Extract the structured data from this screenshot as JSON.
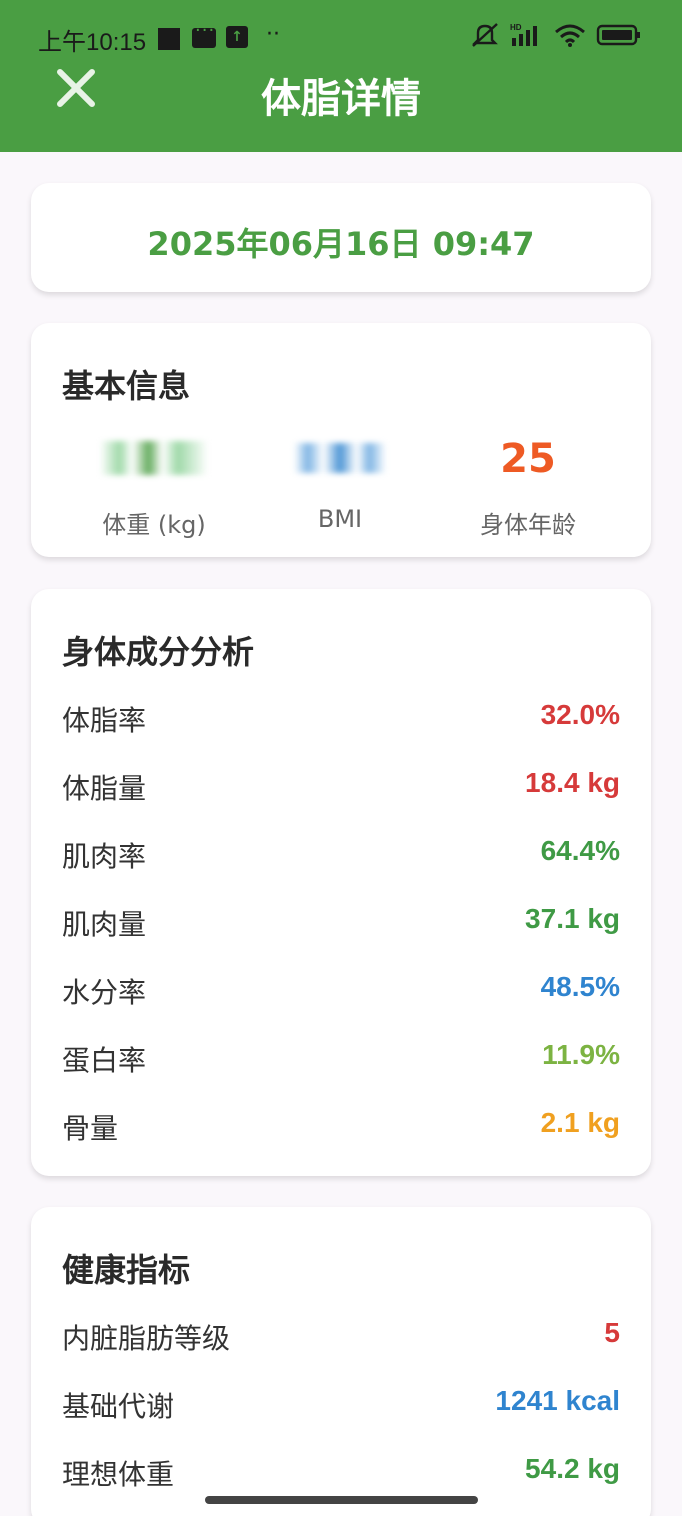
{
  "status_bar": {
    "time": "上午10:15",
    "dots": "··"
  },
  "header": {
    "title": "体脂详情",
    "close_icon": "close-icon"
  },
  "date": "2025年06月16日 09:47",
  "basic_info": {
    "title": "基本信息",
    "stats": [
      {
        "label": "体重 (kg)",
        "value": "",
        "note": "value obscured"
      },
      {
        "label": "BMI",
        "value": "",
        "note": "value obscured"
      },
      {
        "label": "身体年龄",
        "value": "25"
      }
    ]
  },
  "composition": {
    "title": "身体成分分析",
    "rows": [
      {
        "label": "体脂率",
        "value": "32.0%",
        "color": "#d63a3a"
      },
      {
        "label": "体脂量",
        "value": "18.4 kg",
        "color": "#d63a3a"
      },
      {
        "label": "肌肉率",
        "value": "64.4%",
        "color": "#3f9a45"
      },
      {
        "label": "肌肉量",
        "value": "37.1 kg",
        "color": "#3f9a45"
      },
      {
        "label": "水分率",
        "value": "48.5%",
        "color": "#2f84cf"
      },
      {
        "label": "蛋白率",
        "value": "11.9%",
        "color": "#7cb342"
      },
      {
        "label": "骨量",
        "value": "2.1 kg",
        "color": "#f0a020"
      }
    ]
  },
  "health": {
    "title": "健康指标",
    "rows": [
      {
        "label": "内脏脂肪等级",
        "value": "5",
        "color": "#d63a3a"
      },
      {
        "label": "基础代谢",
        "value": "1241 kcal",
        "color": "#2f84cf"
      },
      {
        "label": "理想体重",
        "value": "54.2 kg",
        "color": "#3f9a45"
      }
    ]
  },
  "colors": {
    "primary": "#4a9e43",
    "body_age": "#ee5a24"
  }
}
